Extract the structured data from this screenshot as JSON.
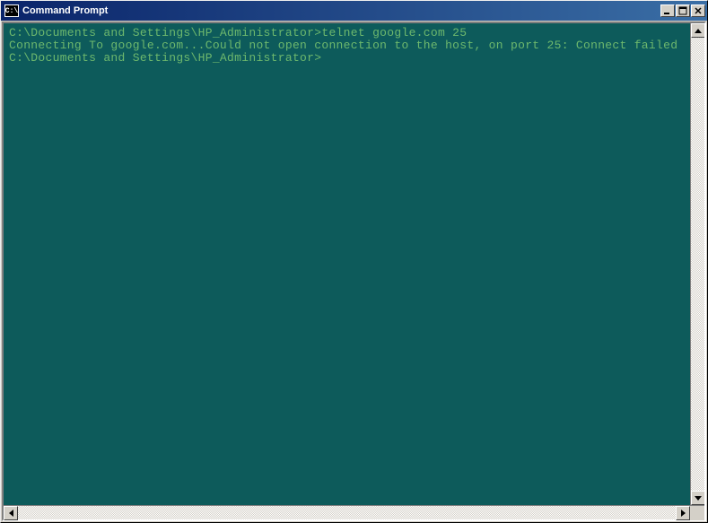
{
  "window": {
    "title": "Command Prompt",
    "icon_text": "C:\\"
  },
  "terminal": {
    "lines": [
      "C:\\Documents and Settings\\HP_Administrator>telnet google.com 25",
      "Connecting To google.com...Could not open connection to the host, on port 25: Connect failed",
      "",
      "C:\\Documents and Settings\\HP_Administrator>"
    ],
    "bg_color": "#0d5b5b",
    "fg_color": "#6db86d"
  }
}
